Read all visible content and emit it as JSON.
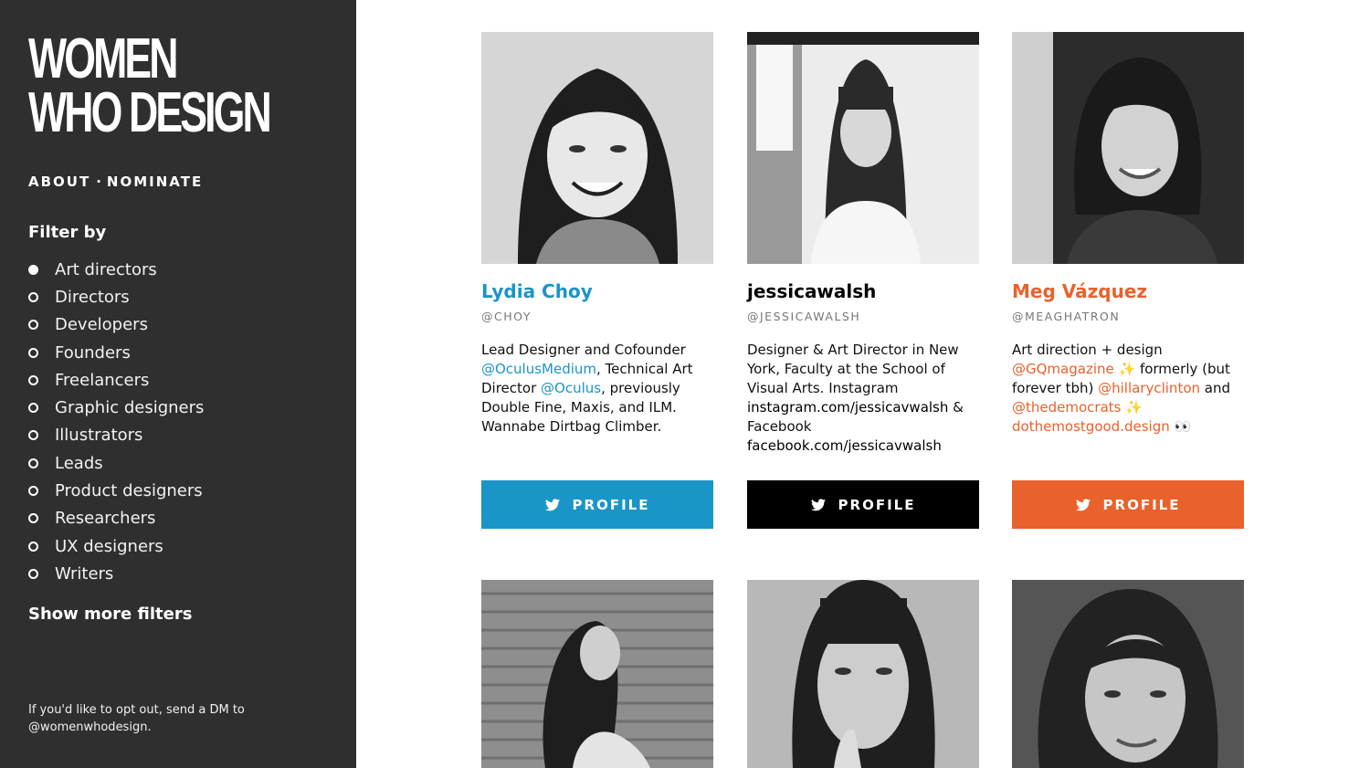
{
  "sidebar": {
    "logo_line1": "WOMEN",
    "logo_line2": "WHO DESIGN",
    "nav": {
      "about": "ABOUT",
      "separator": "·",
      "nominate": "NOMINATE"
    },
    "filter_title": "Filter by",
    "filters": [
      {
        "label": "Art directors",
        "selected": true
      },
      {
        "label": "Directors",
        "selected": false
      },
      {
        "label": "Developers",
        "selected": false
      },
      {
        "label": "Founders",
        "selected": false
      },
      {
        "label": "Freelancers",
        "selected": false
      },
      {
        "label": "Graphic designers",
        "selected": false
      },
      {
        "label": "Illustrators",
        "selected": false
      },
      {
        "label": "Leads",
        "selected": false
      },
      {
        "label": "Product designers",
        "selected": false
      },
      {
        "label": "Researchers",
        "selected": false
      },
      {
        "label": "UX designers",
        "selected": false
      },
      {
        "label": "Writers",
        "selected": false
      }
    ],
    "show_more": "Show more filters",
    "optout": "If you'd like to opt out, send a DM to @womenwhodesign."
  },
  "profiles": [
    {
      "name": "Lydia Choy",
      "handle": "@CHOY",
      "accent": "#1a95c8",
      "bio": [
        {
          "t": "Lead Designer and Cofounder "
        },
        {
          "t": "@OculusMedium",
          "link": true
        },
        {
          "t": ", Technical Art Director "
        },
        {
          "t": "@Oculus",
          "link": true
        },
        {
          "t": ", previously Double Fine, Maxis, and ILM. Wannabe Dirtbag Climber."
        }
      ],
      "button": "PROFILE",
      "button_icon": "twitter-bird-icon"
    },
    {
      "name": "jessicawalsh",
      "handle": "@JESSICAWALSH",
      "accent": "#000000",
      "bio": [
        {
          "t": "Designer & Art Director in New York, Faculty at the School of Visual Arts. Instagram "
        },
        {
          "t": "instagram.com/jessicavwalsh",
          "link": true
        },
        {
          "t": " & Facebook "
        },
        {
          "t": "facebook.com/jessicavwalsh",
          "link": true
        }
      ],
      "button": "PROFILE",
      "button_icon": "twitter-bird-icon"
    },
    {
      "name": "Meg Vázquez",
      "handle": "@MEAGHATRON",
      "accent": "#e9612b",
      "bio": [
        {
          "t": "Art direction + design "
        },
        {
          "t": "@GQmagazine",
          "link": true
        },
        {
          "t": " ✨ formerly (but forever tbh) "
        },
        {
          "t": "@hillaryclinton",
          "link": true
        },
        {
          "t": " and "
        },
        {
          "t": "@thedemocrats",
          "link": true
        },
        {
          "t": " ✨ "
        },
        {
          "t": "dothemostgood.design",
          "link": true
        },
        {
          "t": " 👀"
        }
      ],
      "button": "PROFILE",
      "button_icon": "twitter-bird-icon"
    }
  ],
  "colors": {
    "sidebar_bg": "#2f2f2f",
    "blue": "#1a95c8",
    "black": "#000000",
    "orange": "#e9612b"
  }
}
